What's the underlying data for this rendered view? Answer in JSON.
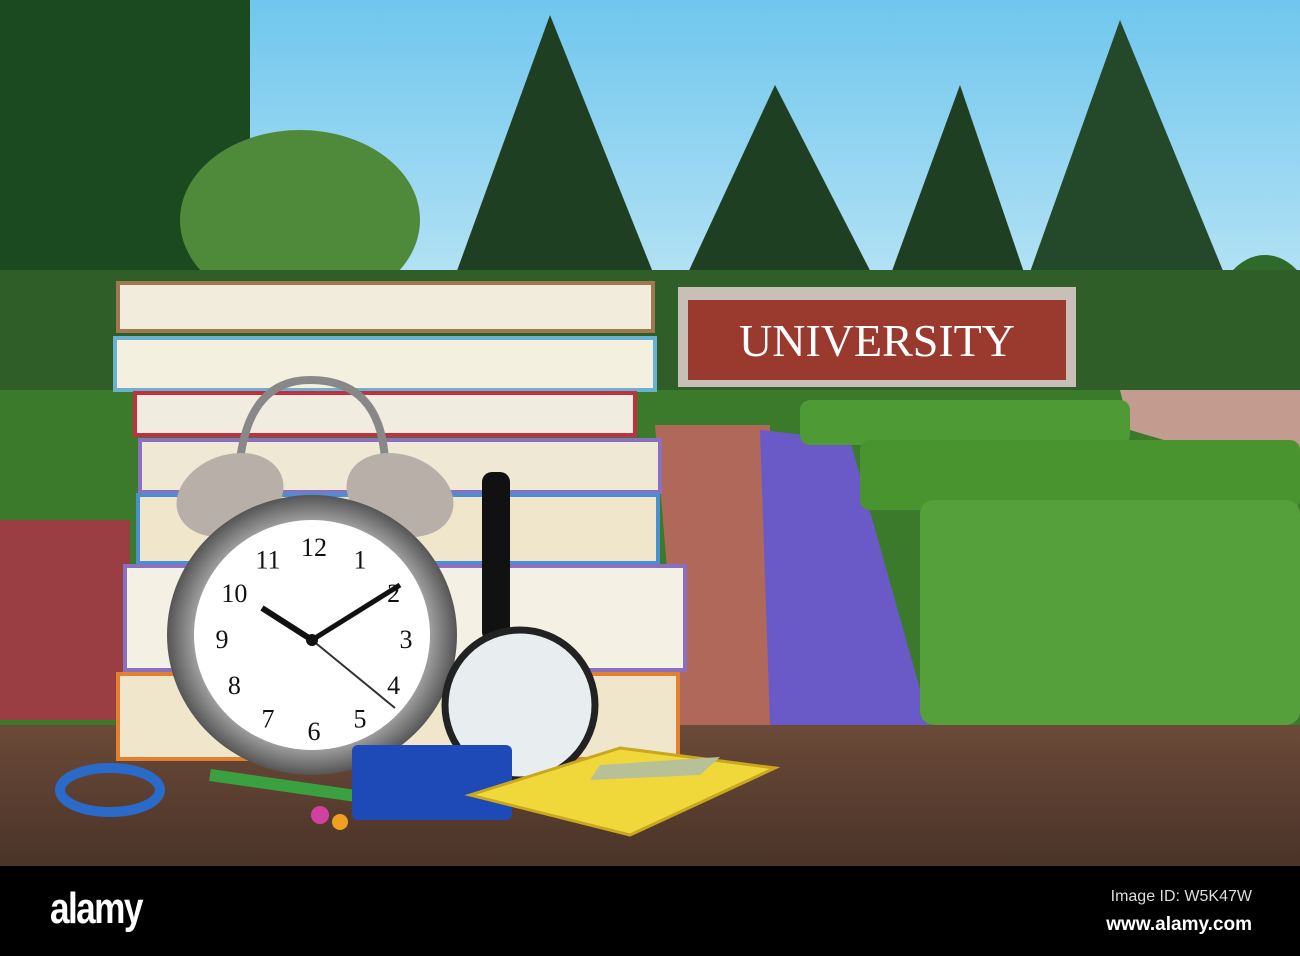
{
  "photo": {
    "sign_text": "UNIVERSITY",
    "clock_numerals": [
      "12",
      "1",
      "2",
      "3",
      "4",
      "5",
      "6",
      "7",
      "8",
      "9",
      "10",
      "11"
    ],
    "colors": {
      "sky": "#8fd3ef",
      "tree": "#1f4a22",
      "hedge": "#3f8a2c",
      "brick": "#9a3a2e",
      "table": "#5a3f30",
      "calculator": "#f0d83a"
    }
  },
  "footer": {
    "logo": "alamy",
    "image_id": "Image ID: W5K47W",
    "url": "www.alamy.com"
  }
}
